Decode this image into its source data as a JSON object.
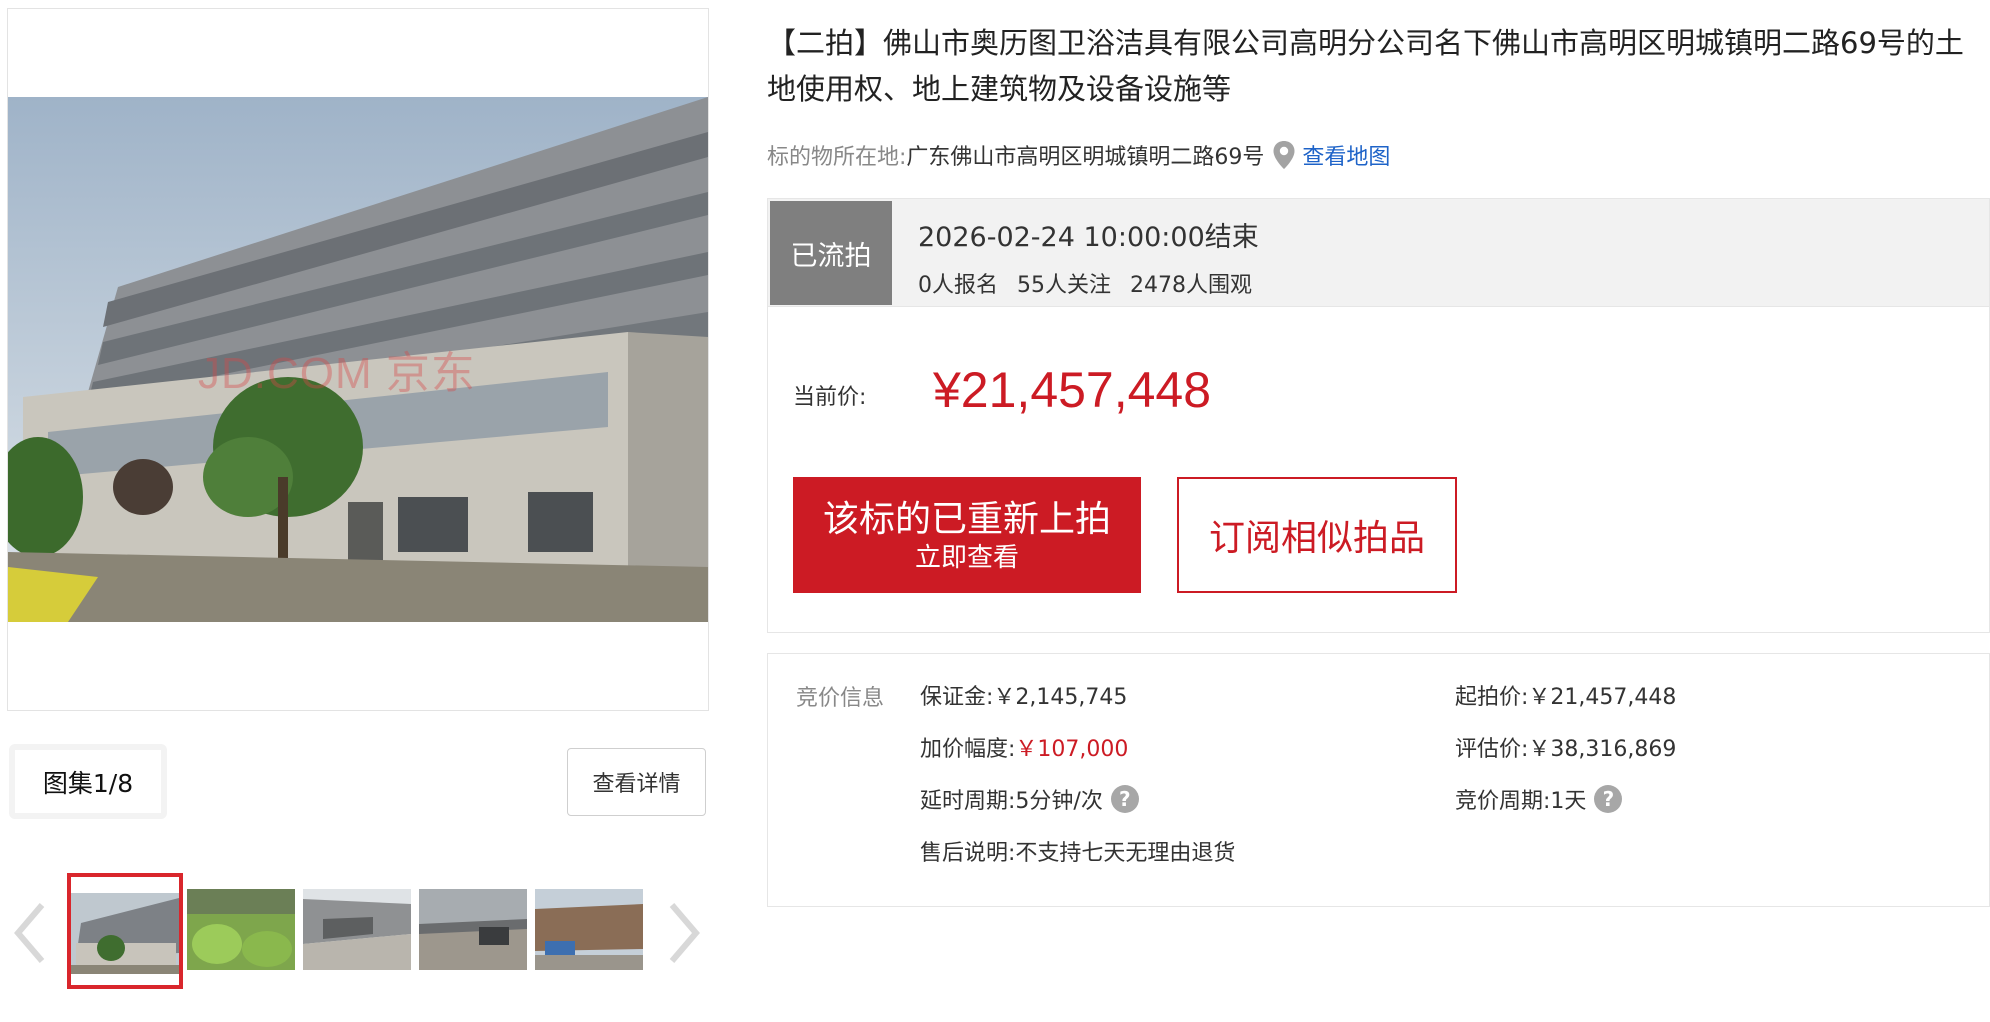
{
  "gallery": {
    "watermark": "JD.COM 京东",
    "album_counter": "图集1/8",
    "view_detail_label": "查看详情"
  },
  "item": {
    "title": "【二拍】佛山市奥历图卫浴洁具有限公司高明分公司名下佛山市高明区明城镇明二路69号的土地使用权、地上建筑物及设备设施等",
    "location_label": "标的物所在地:",
    "location_value": "广东佛山市高明区明城镇明二路69号",
    "map_link": "查看地图"
  },
  "auction": {
    "status": "已流拍",
    "end_time": "2026-02-24 10:00:00结束",
    "stats": {
      "registered": "0人报名",
      "followers": "55人关注",
      "viewers": "2478人围观"
    },
    "current_price_label": "当前价:",
    "current_price": "¥21,457,448",
    "relist_button": {
      "main": "该标的已重新上拍",
      "sub": "立即查看"
    },
    "subscribe_button": "订阅相似拍品"
  },
  "bid_info": {
    "section_label": "竞价信息",
    "deposit": {
      "label": "保证金:",
      "value": "￥2,145,745"
    },
    "starting_price": {
      "label": "起拍价:",
      "value": "￥21,457,448"
    },
    "increment": {
      "label": "加价幅度:",
      "value": "￥107,000"
    },
    "appraisal": {
      "label": "评估价:",
      "value": "￥38,316,869"
    },
    "delay_period": {
      "label": "延时周期:",
      "value": "5分钟/次"
    },
    "bid_period": {
      "label": "竞价周期:",
      "value": "1天"
    },
    "after_sale": {
      "label": "售后说明:",
      "value": "不支持七天无理由退货"
    }
  },
  "colors": {
    "accent_red": "#cc1b24",
    "status_gray": "#7f7f7f",
    "link_blue": "#1e63c8"
  }
}
